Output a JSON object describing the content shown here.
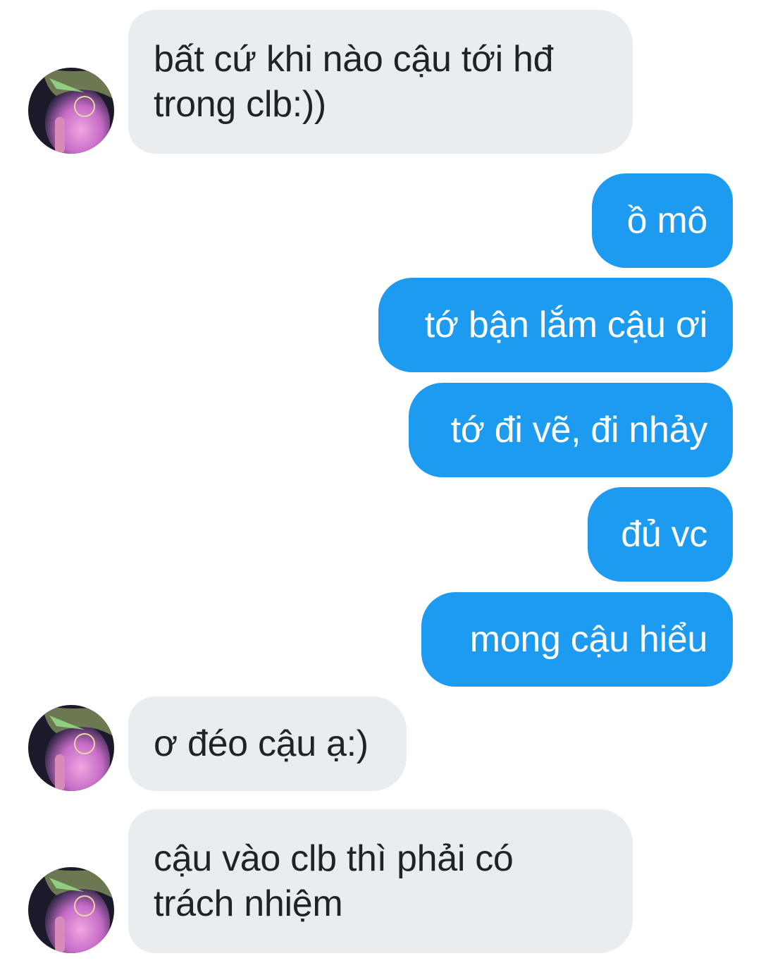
{
  "messages": [
    {
      "side": "in",
      "text_lines": [
        "bất cứ khi nào cậu tới hđ",
        "trong clb:))"
      ]
    },
    {
      "side": "out",
      "text": "ồ mô"
    },
    {
      "side": "out",
      "text": "tớ bận lắm cậu ơi"
    },
    {
      "side": "out",
      "text": "tớ đi vẽ, đi nhảy"
    },
    {
      "side": "out",
      "text": "đủ vc"
    },
    {
      "side": "out",
      "text": "mong cậu hiểu"
    },
    {
      "side": "in",
      "text": "ơ đéo cậu ạ:)"
    },
    {
      "side": "in",
      "text_lines": [
        "cậu vào clb thì phải có",
        "trách nhiệm"
      ]
    }
  ],
  "colors": {
    "incoming_bubble": "#e9edf0",
    "outgoing_bubble": "#1d9bf0",
    "incoming_text": "#1f2326",
    "outgoing_text": "#ffffff"
  },
  "icons": {
    "avatar": "contact-avatar-photo"
  }
}
